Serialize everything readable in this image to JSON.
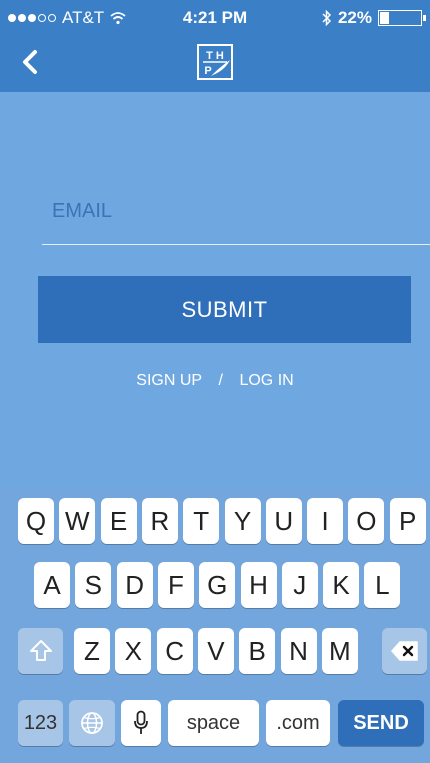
{
  "status": {
    "carrier": "AT&T",
    "time": "4:21 PM",
    "battery_text": "22%",
    "battery_level": 0.22
  },
  "header": {
    "back_icon": "chevron-left-icon",
    "logo_icon": "thp-quill-logo-icon"
  },
  "form": {
    "email_placeholder": "EMAIL",
    "submit_label": "SUBMIT",
    "signup_label": "SIGN UP",
    "separator": "/",
    "login_label": "LOG IN"
  },
  "keyboard": {
    "row1": [
      "Q",
      "W",
      "E",
      "R",
      "T",
      "Y",
      "U",
      "I",
      "O",
      "P"
    ],
    "row2": [
      "A",
      "S",
      "D",
      "F",
      "G",
      "H",
      "J",
      "K",
      "L"
    ],
    "row3": [
      "Z",
      "X",
      "C",
      "V",
      "B",
      "N",
      "M"
    ],
    "numbers_label": "123",
    "space_label": "space",
    "com_label": ".com",
    "send_label": "SEND"
  },
  "colors": {
    "header": "#3b7fc6",
    "background": "#6fa8e1",
    "button": "#2f6eb8",
    "keyboard": "#72a6dd"
  }
}
